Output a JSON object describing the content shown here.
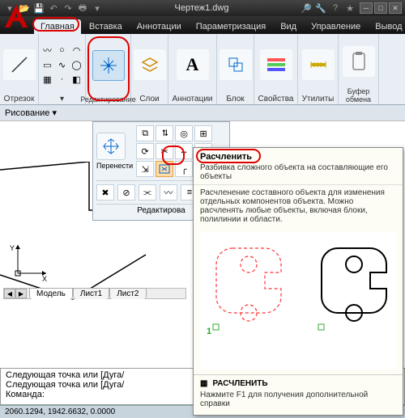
{
  "title": "Чертеж1.dwg",
  "tabs": [
    "Главная",
    "Вставка",
    "Аннотации",
    "Параметризация",
    "Вид",
    "Управление",
    "Вывод"
  ],
  "activeTab": 0,
  "panels": {
    "segment": "Отрезок",
    "edit": "Редактирование",
    "layers": "Слои",
    "annot": "Аннотации",
    "block": "Блок",
    "props": "Свойства",
    "util": "Утилиты",
    "clip": "Буфер обмена"
  },
  "drawbar": "Рисование ▾",
  "flyout": {
    "move": "Перенести",
    "footer": "Редактирова"
  },
  "tooltip": {
    "title": "Расчленить",
    "sub": "Разбивка сложного объекта на составляющие его объекты",
    "desc": "Расчленение составного объекта для изменения отдельных компонентов объекта. Можно расчленять любые объекты, включая блоки, полилинии и области.",
    "cmd": "РАСЧЛЕНИТЬ",
    "f1": "Нажмите F1 для получения дополнительной справки",
    "marker": "1"
  },
  "modelTabs": [
    "Модель",
    "Лист1",
    "Лист2"
  ],
  "cmd": {
    "l1": "Следующая точка или [Дуга/",
    "l2": "Следующая точка или [Дуга/",
    "prompt": "Команда:"
  },
  "status": "2060.1294, 1942.6632, 0.0000",
  "axes": {
    "x": "X",
    "y": "Y"
  }
}
